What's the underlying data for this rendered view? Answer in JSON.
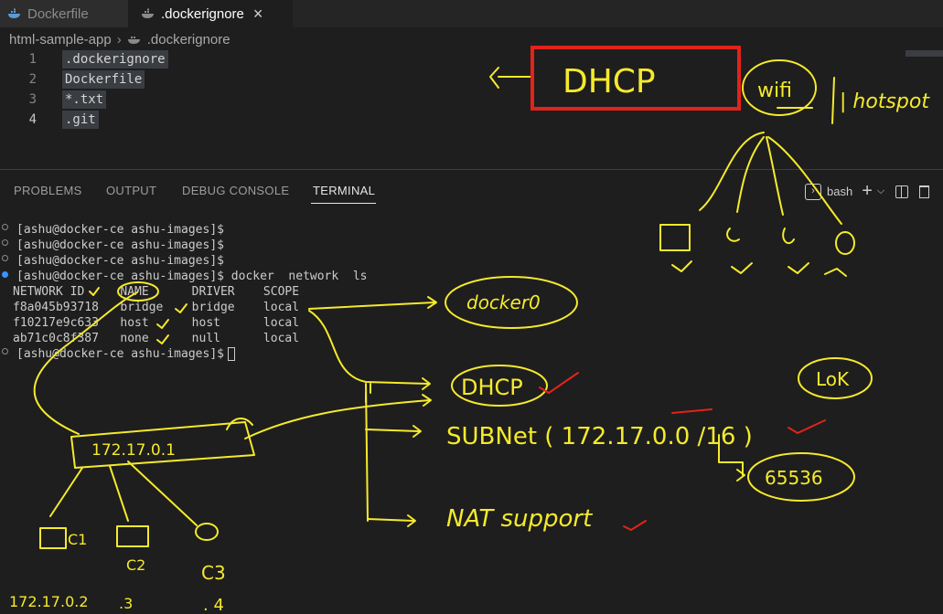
{
  "tabs": [
    {
      "label": "Dockerfile",
      "active": false
    },
    {
      "label": ".dockerignore",
      "active": true
    }
  ],
  "breadcrumb": {
    "folder": "html-sample-app",
    "file": ".dockerignore"
  },
  "editor": {
    "lines": [
      {
        "number": "1",
        "text": ".dockerignore"
      },
      {
        "number": "2",
        "text": "Dockerfile"
      },
      {
        "number": "3",
        "text": "*.txt"
      },
      {
        "number": "4",
        "text": ".git"
      }
    ]
  },
  "panel": {
    "tabs": [
      "PROBLEMS",
      "OUTPUT",
      "DEBUG CONSOLE",
      "TERMINAL"
    ],
    "active_tab": "TERMINAL",
    "shell": "bash"
  },
  "terminal": {
    "lines": [
      "[ashu@docker-ce ashu-images]$",
      "[ashu@docker-ce ashu-images]$",
      "[ashu@docker-ce ashu-images]$",
      "[ashu@docker-ce ashu-images]$ docker  network  ls",
      "NETWORK ID     NAME      DRIVER    SCOPE",
      "f8a045b93718   bridge    bridge    local",
      "f10217e9c633   host      host      local",
      "ab71c0c8f387   none      null      local",
      "[ashu@docker-ce ashu-images]$"
    ]
  },
  "annotations": {
    "dhcp_box": "DHCP",
    "wifi": "wifi",
    "hotspot": "| hotspot",
    "docker0": "docker0",
    "dhcp": "DHCP",
    "subnet": "SUBNet  (  172.17.0.0 /16 )",
    "nat": "NAT support",
    "ip": "172.17.0.1",
    "c1": "C1",
    "c2": "C2",
    "c3": "C3",
    "ip2": "172.17.0.2",
    "ip3": ".3",
    "ip4": ". 4",
    "count": "65536",
    "lok": "LoK",
    "colors": {
      "ink": "#f5ea2c",
      "red": "#e2231a"
    }
  }
}
